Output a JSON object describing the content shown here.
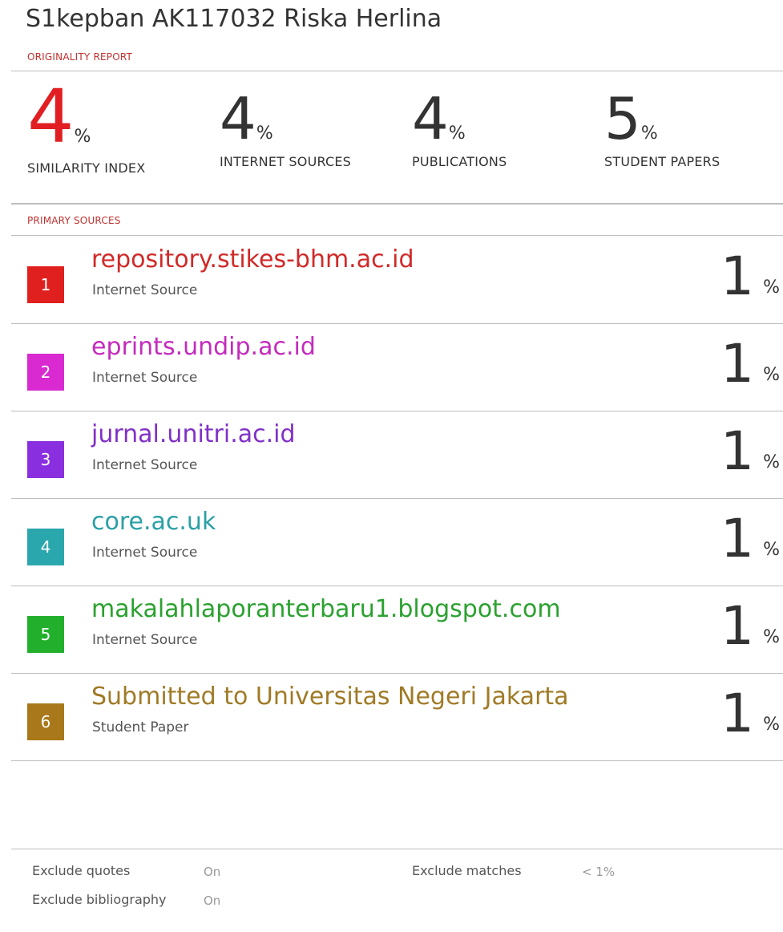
{
  "title": "S1kepban AK117032 Riska Herlina",
  "originality_label": "ORIGINALITY REPORT",
  "stats": [
    {
      "value": "4",
      "unit": "%",
      "label": "SIMILARITY INDEX",
      "color": "#e11f22"
    },
    {
      "value": "4",
      "unit": "%",
      "label": "INTERNET SOURCES"
    },
    {
      "value": "4",
      "unit": "%",
      "label": "PUBLICATIONS"
    },
    {
      "value": "5",
      "unit": "%",
      "label": "STUDENT PAPERS"
    }
  ],
  "primary_label": "PRIMARY SOURCES",
  "sources": [
    {
      "rank": "1",
      "name": "repository.stikes-bhm.ac.id",
      "type": "Internet Source",
      "value": "1",
      "unit": "%",
      "color": "#e0201e",
      "text_color": "#d02a28"
    },
    {
      "rank": "2",
      "name": "eprints.undip.ac.id",
      "type": "Internet Source",
      "value": "1",
      "unit": "%",
      "color": "#d82ad0",
      "text_color": "#c42bbd"
    },
    {
      "rank": "3",
      "name": "jurnal.unitri.ac.id",
      "type": "Internet Source",
      "value": "1",
      "unit": "%",
      "color": "#8a2fe0",
      "text_color": "#8130c8"
    },
    {
      "rank": "4",
      "name": "core.ac.uk",
      "type": "Internet Source",
      "value": "1",
      "unit": "%",
      "color": "#2aa6ad",
      "text_color": "#2aa0a6"
    },
    {
      "rank": "5",
      "name": "makalahlaporanterbaru1.blogspot.com",
      "type": "Internet Source",
      "value": "1",
      "unit": "%",
      "color": "#22b02c",
      "text_color": "#2ba12f"
    },
    {
      "rank": "6",
      "name": "Submitted to Universitas Negeri Jakarta",
      "type": "Student Paper",
      "value": "1",
      "unit": "%",
      "color": "#a8781a",
      "text_color": "#a07a26"
    }
  ],
  "footer": {
    "exclude_quotes_label": "Exclude quotes",
    "exclude_quotes_value": "On",
    "exclude_bibliography_label": "Exclude bibliography",
    "exclude_bibliography_value": "On",
    "exclude_matches_label": "Exclude matches",
    "exclude_matches_value": "< 1%"
  }
}
